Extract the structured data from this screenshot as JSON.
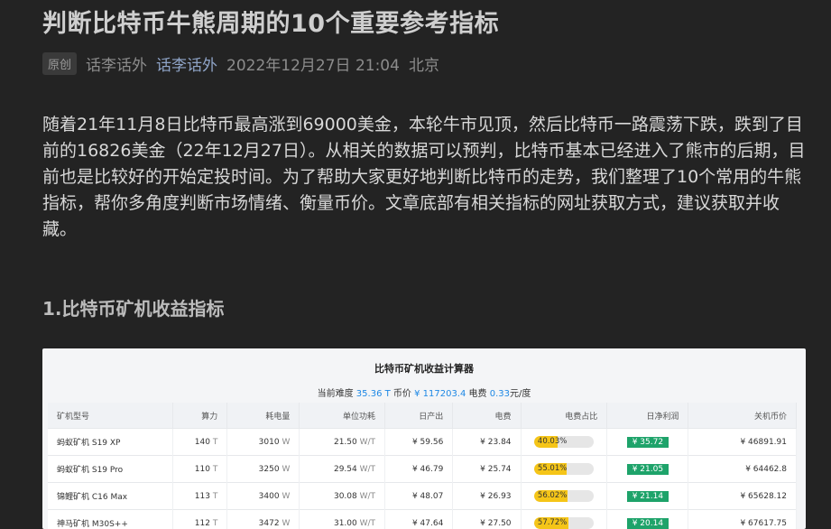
{
  "article": {
    "title": "判断比特币牛熊周期的10个重要参考指标",
    "badge": "原创",
    "author": "话李话外",
    "account": "话李话外",
    "datetime": "2022年12月27日 21:04",
    "location": "北京",
    "paragraph": "随着21年11月8日比特币最高涨到69000美金，本轮牛市见顶，然后比特币一路震荡下跌，跌到了目前的16826美金（22年12月27日）。从相关的数据可以预判，比特币基本已经进入了熊市的后期，目前也是比较好的开始定投时间。为了帮助大家更好地判断比特币的走势，我们整理了10个常用的牛熊指标，帮你多角度判断市场情绪、衡量币价。文章底部有相关指标的网址获取方式，建议获取并收藏。",
    "section1": "1.比特币矿机收益指标"
  },
  "calculator": {
    "title": "比特币矿机收益计算器",
    "difficulty_label": "当前难度",
    "difficulty": "35.36 T",
    "price_label": "币价",
    "price": "¥ 117203.4",
    "power_label": "电费",
    "power_price": "0.33",
    "power_unit": "元/度",
    "columns": [
      "矿机型号",
      "算力",
      "耗电量",
      "单位功耗",
      "日产出",
      "电费",
      "电费占比",
      "日净利润",
      "关机币价"
    ],
    "rows": [
      {
        "model": "蚂蚁矿机 S19 XP",
        "hashrate": "140",
        "hashrate_unit": "T",
        "power": "3010",
        "power_unit": "W",
        "efficiency": "21.50",
        "eff_unit": "W/T",
        "output": "¥ 59.56",
        "cost": "¥ 23.84",
        "ratio": "40.03%",
        "ratio_value": 40.03,
        "profit": "¥ 35.72",
        "shutdown": "¥ 46891.91"
      },
      {
        "model": "蚂蚁矿机 S19 Pro",
        "hashrate": "110",
        "hashrate_unit": "T",
        "power": "3250",
        "power_unit": "W",
        "efficiency": "29.54",
        "eff_unit": "W/T",
        "output": "¥ 46.79",
        "cost": "¥ 25.74",
        "ratio": "55.01%",
        "ratio_value": 55.01,
        "profit": "¥ 21.05",
        "shutdown": "¥ 64462.8"
      },
      {
        "model": "锦鲤矿机 C16 Max",
        "hashrate": "113",
        "hashrate_unit": "T",
        "power": "3400",
        "power_unit": "W",
        "efficiency": "30.08",
        "eff_unit": "W/T",
        "output": "¥ 48.07",
        "cost": "¥ 26.93",
        "ratio": "56.02%",
        "ratio_value": 56.02,
        "profit": "¥ 21.14",
        "shutdown": "¥ 65628.12"
      },
      {
        "model": "神马矿机 M30S++",
        "hashrate": "112",
        "hashrate_unit": "T",
        "power": "3472",
        "power_unit": "W",
        "efficiency": "31.00",
        "eff_unit": "W/T",
        "output": "¥ 47.64",
        "cost": "¥ 27.50",
        "ratio": "57.72%",
        "ratio_value": 57.72,
        "profit": "¥ 20.14",
        "shutdown": "¥ 67617.75"
      }
    ]
  }
}
